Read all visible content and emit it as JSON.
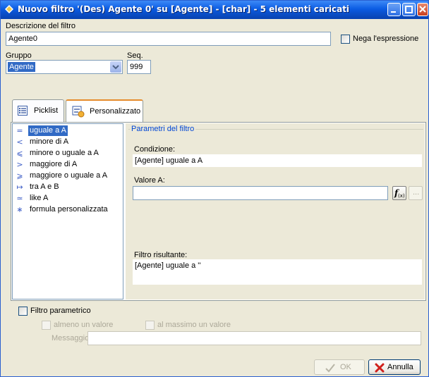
{
  "window": {
    "title": "Nuovo filtro '(Des) Agente 0' su [Agente] - [char] - 5 elementi caricati"
  },
  "description": {
    "label": "Descrizione del filtro",
    "value": "Agente0",
    "negate_label": "Nega l'espressione"
  },
  "group": {
    "label": "Gruppo",
    "value": "Agente"
  },
  "seq": {
    "label": "Seq.",
    "value": "999"
  },
  "tabs": [
    {
      "label": "Picklist"
    },
    {
      "label": "Personalizzato"
    }
  ],
  "operators": [
    {
      "symbol": "=",
      "label": "uguale a A",
      "selected": true
    },
    {
      "symbol": "<",
      "label": "minore di A"
    },
    {
      "symbol": "⩽",
      "label": "minore o uguale a A"
    },
    {
      "symbol": ">",
      "label": "maggiore di A"
    },
    {
      "symbol": "⩾",
      "label": "maggiore o uguale a A"
    },
    {
      "symbol": "↦",
      "label": "tra A e B"
    },
    {
      "symbol": "≃",
      "label": "like A"
    },
    {
      "symbol": "∗",
      "label": "formula personalizzata"
    }
  ],
  "params": {
    "legend": "Parametri del filtro",
    "condition_label": "Condizione:",
    "condition_value": "[Agente] uguale a A",
    "value_a_label": "Valore A:",
    "value_a": "",
    "result_label": "Filtro risultante:",
    "result_value": "[Agente] uguale a ''",
    "more_label": "..."
  },
  "parametric": {
    "label": "Filtro parametrico",
    "at_least_one": "almeno un valore",
    "at_most_one": "al massimo un valore",
    "message_label": "Messaggio",
    "message_value": ""
  },
  "buttons": {
    "ok": "OK",
    "cancel": "Annulla"
  },
  "colors": {
    "selection": "#316ac5",
    "titlebar": "#0b5ce3",
    "legend": "#0046d5"
  }
}
